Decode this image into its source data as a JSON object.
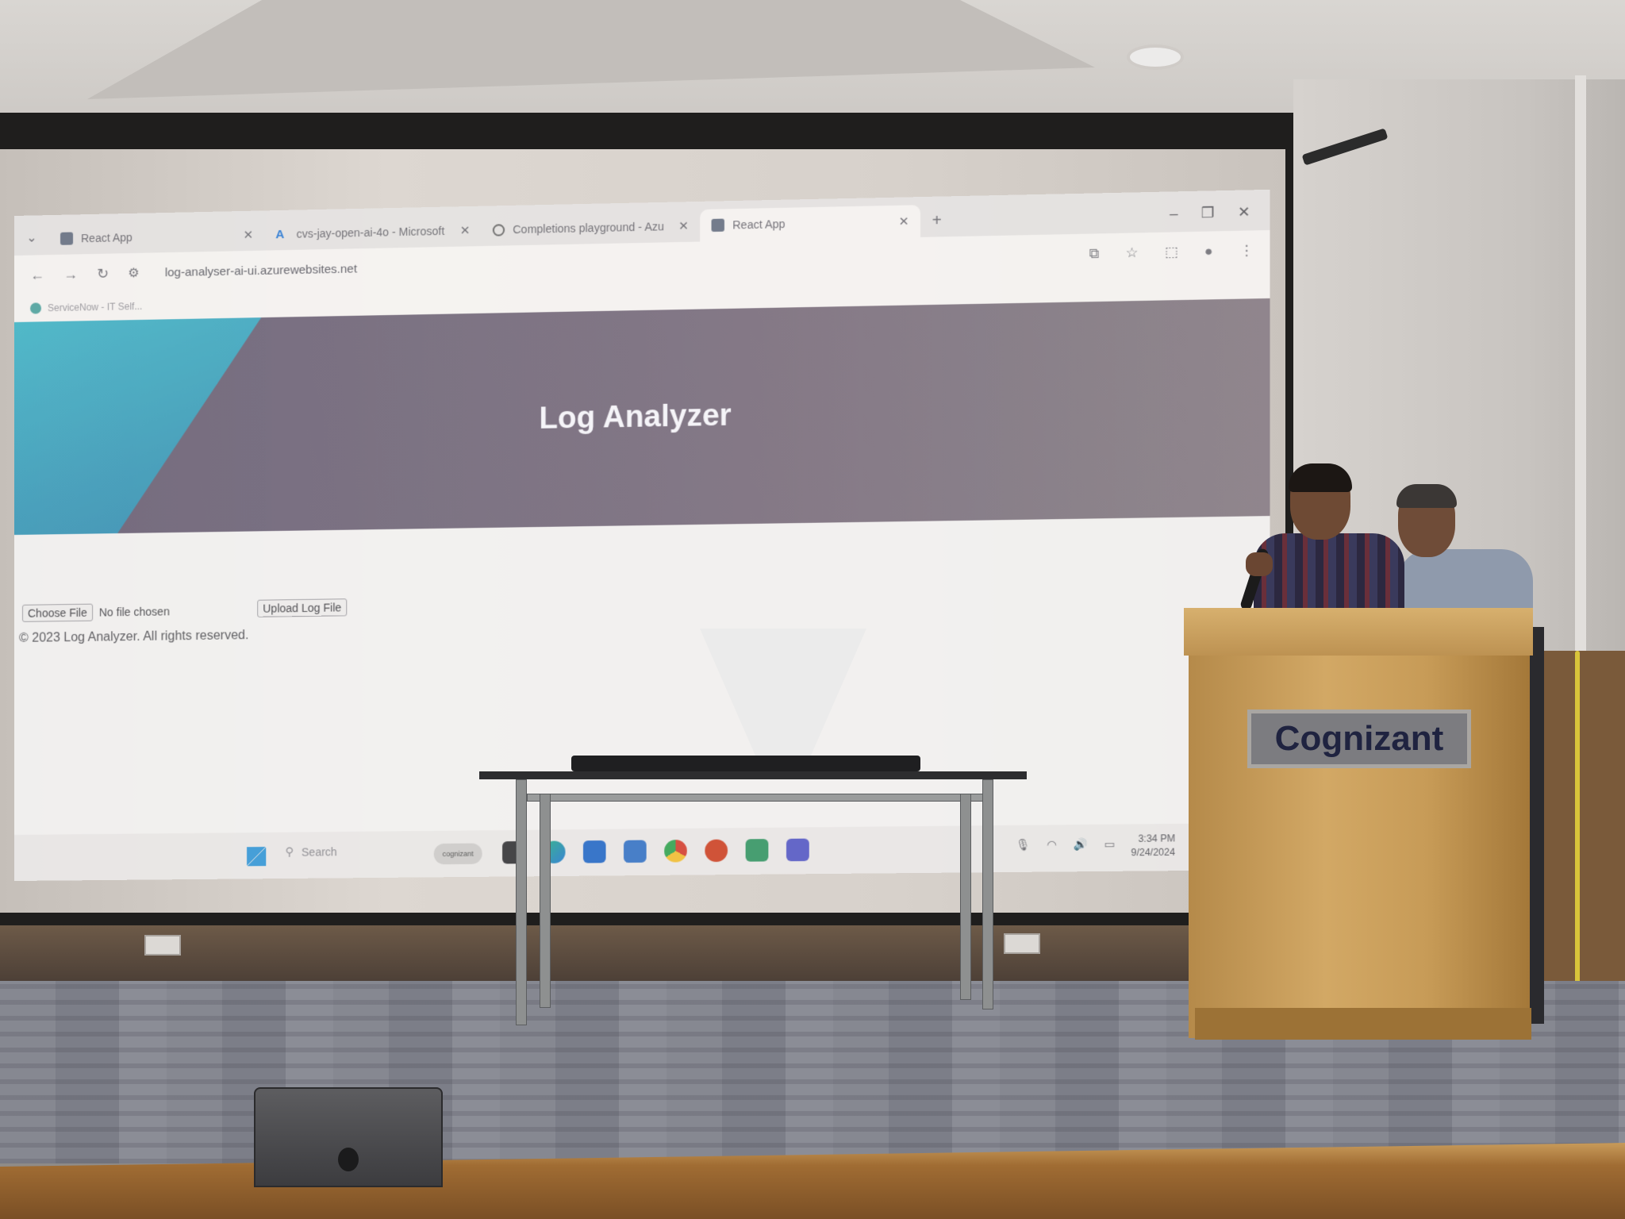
{
  "browser": {
    "tabs": [
      {
        "title": "React App",
        "icon": "react-app-icon"
      },
      {
        "title": "cvs-jay-open-ai-4o - Microsoft",
        "icon": "azure-icon"
      },
      {
        "title": "Completions playground - Azu",
        "icon": "globe-icon"
      },
      {
        "title": "React App",
        "icon": "react-app-icon"
      }
    ],
    "new_tab": "+",
    "window_controls": {
      "minimize": "–",
      "restore": "❐",
      "close": "✕"
    },
    "url": "log-analyser-ai-ui.azurewebsites.net",
    "bookmark": "ServiceNow - IT Self..."
  },
  "page": {
    "title": "Log Analyzer",
    "choose_file": "Choose File",
    "no_file": "No file chosen",
    "upload": "Upload Log File",
    "footer": "© 2023 Log Analyzer. All rights reserved."
  },
  "taskbar": {
    "search": "Search",
    "pill": "cognizant",
    "time": "3:34 PM",
    "date": "9/24/2024"
  },
  "podium": {
    "logo": "Cognizant"
  },
  "colors": {
    "hero": "#756b7c",
    "hero_accent": "#49b8c9",
    "podium_wood": "#c79b57"
  }
}
